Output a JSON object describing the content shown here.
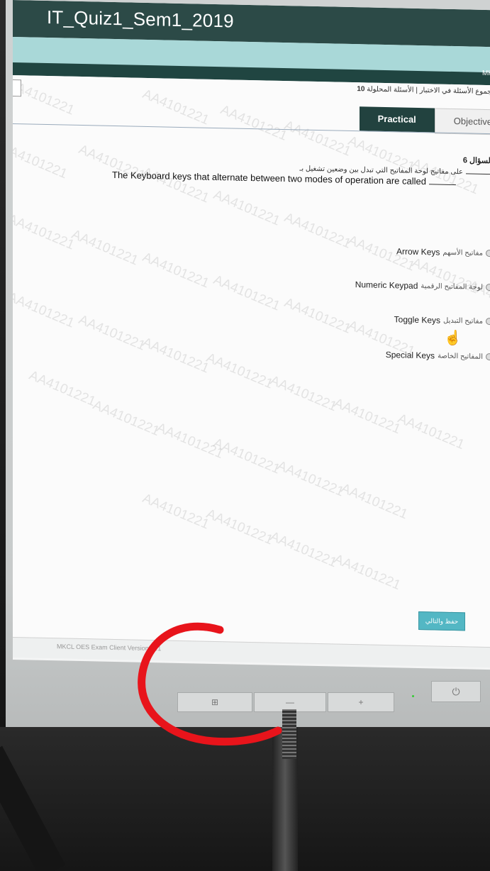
{
  "window": {
    "title": "IT_Quiz1_Sem1_2019",
    "brand": "MK"
  },
  "exam": {
    "info_ar": "مجموع الأسئلة في الاختبار | الأسئلة المحلولة",
    "info_count": "10",
    "tabs": [
      {
        "label": "Practical",
        "active": true
      },
      {
        "label": "Objective",
        "active": false
      }
    ]
  },
  "question": {
    "number_label": "السؤال 6",
    "text_ar": "على مفاتيح لوحة المفاتيح التي تبدل بين وضعين تشغيل بـ",
    "text_en": "The Keyboard keys that alternate between two modes of operation are called",
    "options": [
      {
        "en": "Arrow Keys",
        "ar": "مفاتيح الأسهم"
      },
      {
        "en": "Numeric Keypad",
        "ar": "لوحة المفاتيح الرقمية"
      },
      {
        "en": "Toggle Keys",
        "ar": "مفاتيح التبديل"
      },
      {
        "en": "Special Keys",
        "ar": "المفاتيح الخاصة"
      }
    ]
  },
  "watermark_text": "AA4101221",
  "actions": {
    "save_next": "حفظ والتالي"
  },
  "footer": {
    "version": "MKCL OES Exam Client Version: 1.1"
  },
  "monitor": {
    "buttons": [
      "⊞",
      "—",
      "+"
    ],
    "power": "⏻"
  },
  "colors": {
    "titlebar": "#2c4a47",
    "banner": "#a9d8d8",
    "tab_active": "#22423f",
    "save_button": "#53b7c4",
    "annotation": "#e8141b"
  }
}
